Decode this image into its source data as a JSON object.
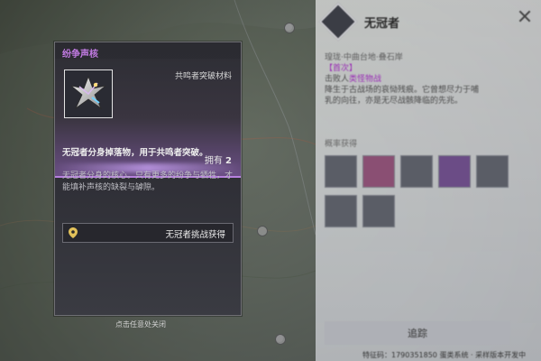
{
  "tooltip": {
    "title": "纷争声核",
    "category": "共鸣者突破材料",
    "owned_label": "拥有",
    "owned_count": "2",
    "usage": "无冠者分身掉落物，用于共鸣者突破。",
    "lore": "无冠者分身的核心。只有更多的纷争与牺牲，才能填补声核的缺裂与罅隙。",
    "source_label": "无冠者挑战获得"
  },
  "dismiss_hint": "点击任意处关闭",
  "right_panel": {
    "title": "无冠者",
    "location": "瑝珑·中曲台地·叠石岸",
    "tag": "【首次】",
    "desc_line1_a": "击败人",
    "desc_line1_hl": "类怪物战",
    "desc_line2": "降生于古战场的哀恸残痕。它曾想尽力于哺",
    "desc_line3": "乳的向往，亦是无尽战骸降临的先兆。",
    "section_label": "概率获得",
    "track_button": "追踪",
    "footer": "特征码：1790351850 蛋类系统 · 采样版本开发中"
  },
  "colors": {
    "accent_purple": "#b780de",
    "title_purple": "#c27be3"
  }
}
